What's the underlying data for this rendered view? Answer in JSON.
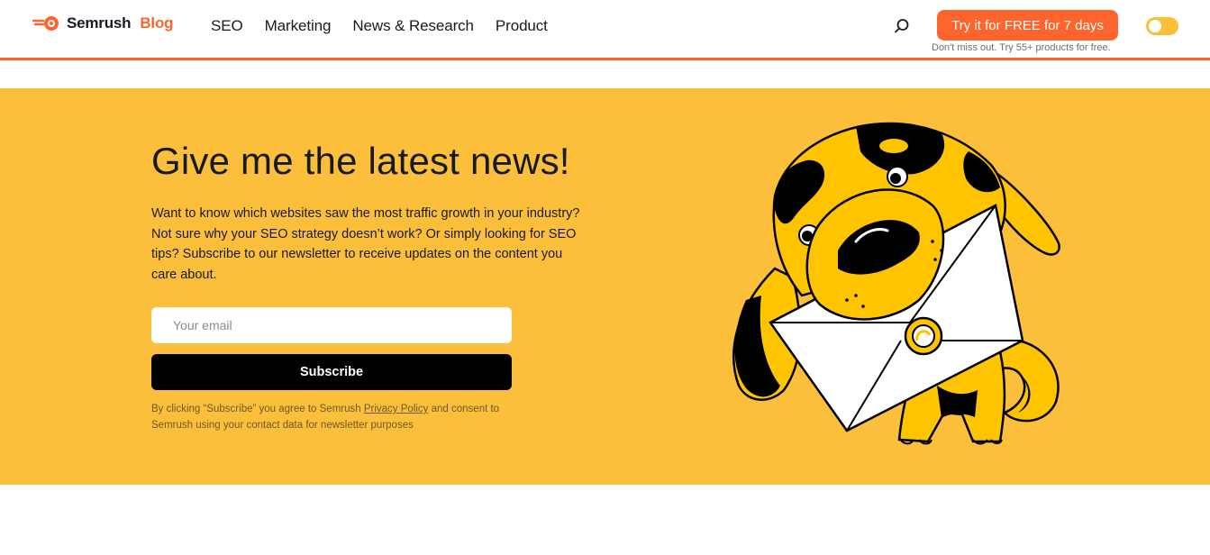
{
  "header": {
    "logo": {
      "brand": "Semrush",
      "suffix": "Blog"
    },
    "nav": [
      {
        "label": "SEO"
      },
      {
        "label": "Marketing"
      },
      {
        "label": "News & Research"
      },
      {
        "label": "Product"
      }
    ],
    "search_icon": "search-icon",
    "cta": {
      "label": "Try it for FREE for 7 days",
      "subtext": "Don't miss out. Try 55+ products for free."
    },
    "theme_toggle": {
      "icon": "theme-toggle",
      "state": "off"
    }
  },
  "newsletter": {
    "title": "Give me the latest news!",
    "description": "Want to know which websites saw the most traffic growth in your industry? Not sure why your SEO strategy doesn’t work? Or simply looking for SEO tips? Subscribe to our newsletter to receive updates on the content you care about.",
    "email": {
      "placeholder": "Your email",
      "value": ""
    },
    "subscribe_label": "Subscribe",
    "consent": {
      "before": "By clicking “Subscribe” you agree to Semrush ",
      "link": "Privacy Policy",
      "after": " and consent to Semrush using your contact data for newsletter purposes"
    },
    "illustration": "dog-holding-envelope"
  },
  "colors": {
    "accent": "#ff642d",
    "banner": "#fbbf3b",
    "text": "#171a22",
    "button": "#000000"
  }
}
